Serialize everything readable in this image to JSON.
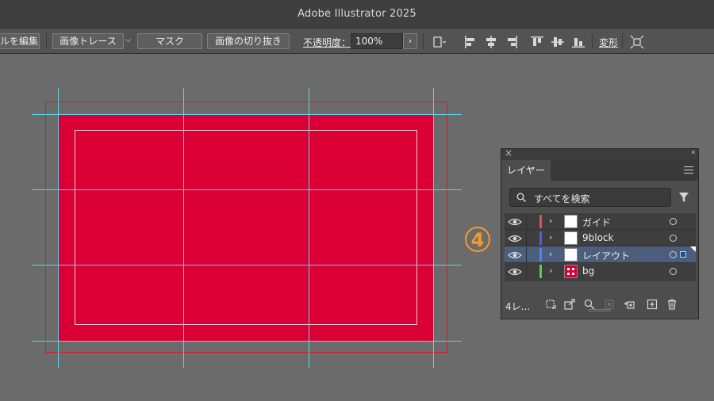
{
  "window": {
    "title": "Adobe Illustrator 2025"
  },
  "controlbar": {
    "edit_label": "ルを編集",
    "image_trace_label": "画像トレース",
    "mask_label": "マスク",
    "crop_label": "画像の切り抜き",
    "opacity_label": "不透明度：",
    "opacity_value": "100%",
    "transform_label": "変形"
  },
  "annotation": {
    "step": "4"
  },
  "layers_panel": {
    "tab_label": "レイヤー",
    "search_placeholder": "すべてを検索",
    "layers": [
      {
        "name": "ガイド",
        "color": "#d8555d",
        "visible": true,
        "selected": false,
        "thumb": "blank"
      },
      {
        "name": "9block",
        "color": "#5a5ad8",
        "visible": true,
        "selected": false,
        "thumb": "blank"
      },
      {
        "name": "レイアウト",
        "color": "#4e86e8",
        "visible": true,
        "selected": true,
        "thumb": "blank"
      },
      {
        "name": "bg",
        "color": "#4fd24f",
        "visible": true,
        "selected": false,
        "thumb": "red"
      }
    ],
    "layer_count_label": "4レ..."
  },
  "colors": {
    "artboard_fill": "#da0036",
    "guide_cyan": "#5ed3e8",
    "bleed_red": "#e0142e",
    "step_orange": "#f49a2b",
    "selected_row": "#4b5e7c"
  }
}
